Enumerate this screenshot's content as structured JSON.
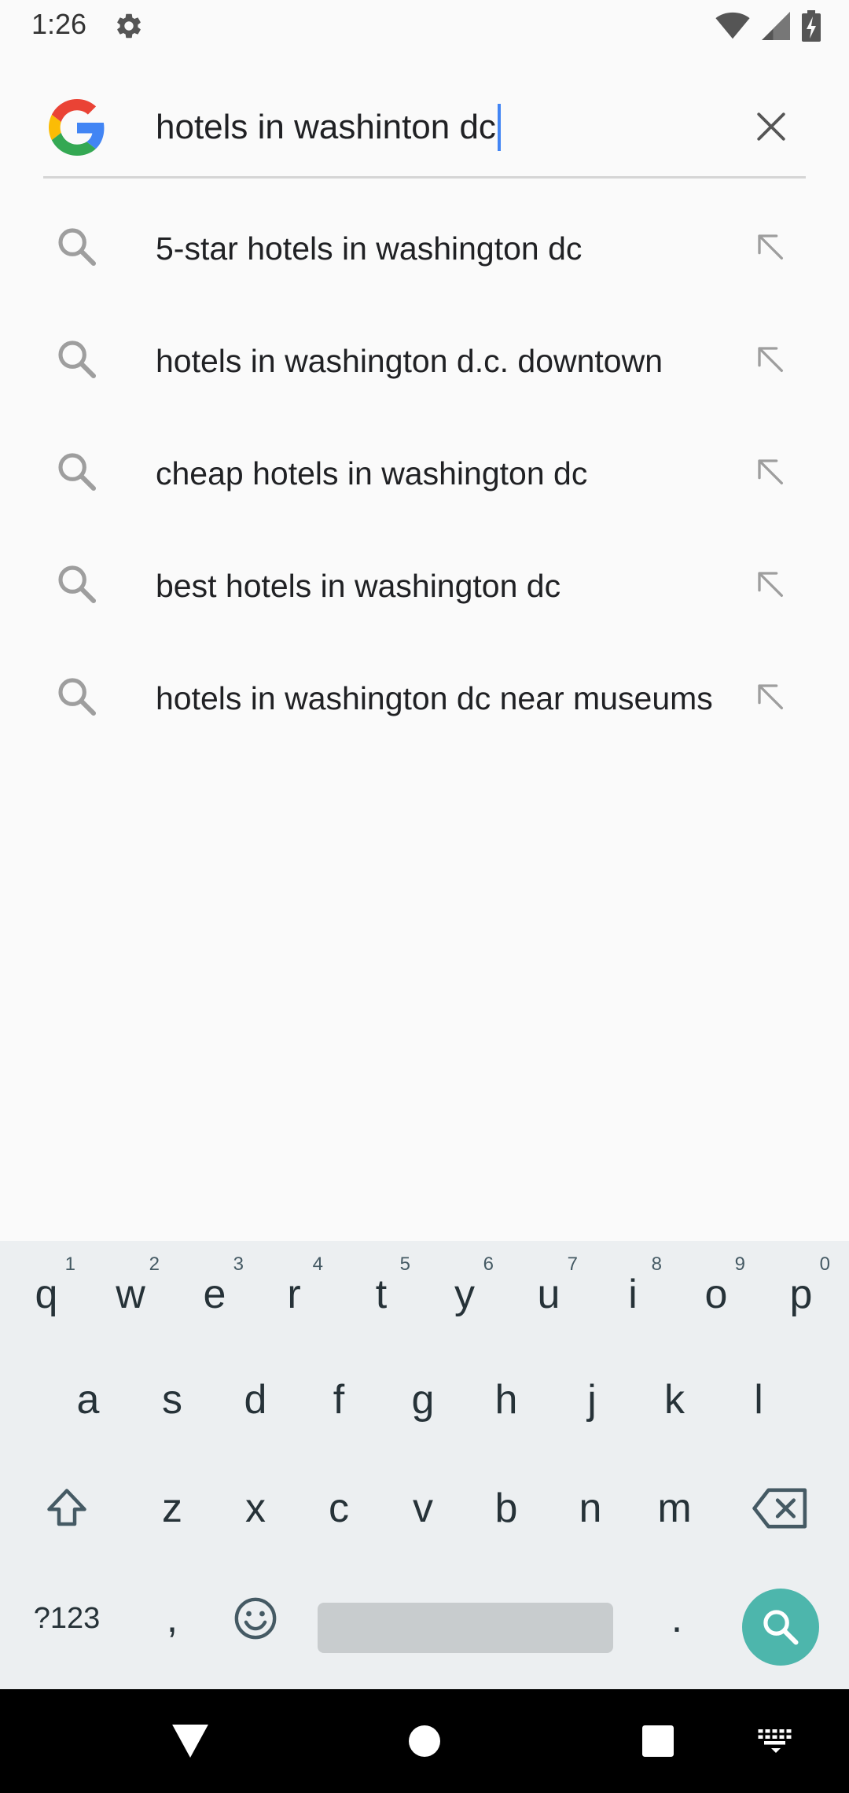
{
  "status_bar": {
    "time": "1:26",
    "icons": [
      "settings-gear-icon",
      "wifi-icon",
      "cell-signal-icon",
      "battery-charging-icon"
    ]
  },
  "search": {
    "query": "hotels in washinton dc",
    "logo": "google-g-logo",
    "clear_icon": "close-icon",
    "caret_color": "#4285f4"
  },
  "suggestions": [
    {
      "text": "5-star hotels in washington dc"
    },
    {
      "text": "hotels in washington d.c. downtown"
    },
    {
      "text": "cheap hotels in washington dc"
    },
    {
      "text": "best hotels in washington dc"
    },
    {
      "text": "hotels in washington dc near museums"
    }
  ],
  "keyboard": {
    "row1": [
      {
        "key": "q",
        "hint": "1"
      },
      {
        "key": "w",
        "hint": "2"
      },
      {
        "key": "e",
        "hint": "3"
      },
      {
        "key": "r",
        "hint": "4"
      },
      {
        "key": "t",
        "hint": "5"
      },
      {
        "key": "y",
        "hint": "6"
      },
      {
        "key": "u",
        "hint": "7"
      },
      {
        "key": "i",
        "hint": "8"
      },
      {
        "key": "o",
        "hint": "9"
      },
      {
        "key": "p",
        "hint": "0"
      }
    ],
    "row2": [
      "a",
      "s",
      "d",
      "f",
      "g",
      "h",
      "j",
      "k",
      "l"
    ],
    "row3": [
      "z",
      "x",
      "c",
      "v",
      "b",
      "n",
      "m"
    ],
    "symbols_label": "?123",
    "comma": ",",
    "period": ".",
    "accent": "#4db6ac"
  },
  "nav_bar": {
    "icons": [
      "back-icon",
      "home-icon",
      "recents-icon",
      "keyboard-switch-icon"
    ]
  }
}
